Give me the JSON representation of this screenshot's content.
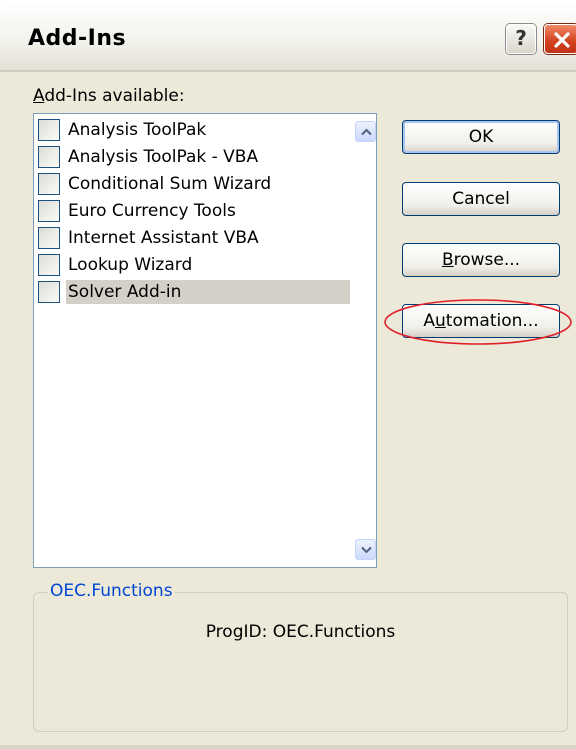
{
  "window": {
    "title": "Add-Ins",
    "help_glyph": "?",
    "close_icon": "close-icon"
  },
  "addins": {
    "label_accel": "A",
    "label_rest": "dd-Ins available:",
    "items": [
      {
        "label": "Analysis ToolPak",
        "checked": false,
        "selected": false
      },
      {
        "label": "Analysis ToolPak - VBA",
        "checked": false,
        "selected": false
      },
      {
        "label": "Conditional Sum Wizard",
        "checked": false,
        "selected": false
      },
      {
        "label": "Euro Currency Tools",
        "checked": false,
        "selected": false
      },
      {
        "label": "Internet Assistant VBA",
        "checked": false,
        "selected": false
      },
      {
        "label": "Lookup Wizard",
        "checked": false,
        "selected": false
      },
      {
        "label": "Solver Add-in",
        "checked": false,
        "selected": true
      }
    ]
  },
  "buttons": {
    "ok": "OK",
    "cancel": "Cancel",
    "browse_accel": "B",
    "browse_rest": "rowse...",
    "automation_pre": "A",
    "automation_accel": "u",
    "automation_rest": "tomation..."
  },
  "details": {
    "group_title": "OEC.Functions",
    "progid": "ProgID: OEC.Functions"
  },
  "colors": {
    "dialog_bg": "#ece9d8",
    "group_title": "#0046d5",
    "highlight_ellipse": "#e0212a",
    "close_button": "#d3401c"
  }
}
